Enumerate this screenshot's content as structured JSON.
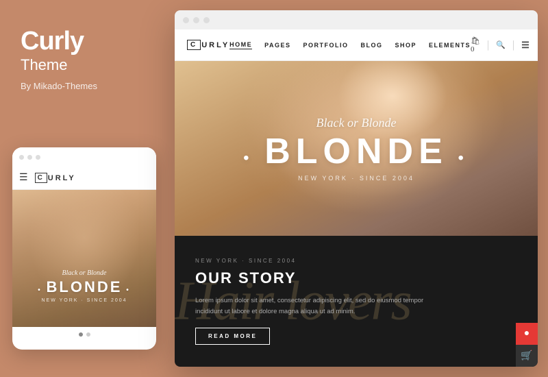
{
  "brand": {
    "title": "Curly",
    "subtitle": "Theme",
    "by": "By Mikado-Themes"
  },
  "mobile": {
    "titlebar_dots": [
      "dot1",
      "dot2",
      "dot3"
    ],
    "logo_letter": "C",
    "logo_text": "URLY",
    "hero": {
      "script": "Black or Blonde",
      "headline": "BLONDE",
      "tagline": "NEW YORK · SINCE 2004"
    },
    "dots": [
      true,
      false
    ]
  },
  "desktop": {
    "nav": {
      "logo_letter": "C",
      "logo_text": "URLY",
      "links": [
        {
          "label": "HOME",
          "active": true
        },
        {
          "label": "PAGES",
          "active": false
        },
        {
          "label": "PORTFOLIO",
          "active": false
        },
        {
          "label": "BLOG",
          "active": false
        },
        {
          "label": "SHOP",
          "active": false
        },
        {
          "label": "ELEMENTS",
          "active": false
        }
      ],
      "cart_label": "0",
      "search_icon": "🔍",
      "menu_icon": "☰"
    },
    "hero": {
      "script": "Black or Blonde",
      "headline": "BLONDE",
      "tagline": "NEW YORK · SINCE 2004"
    },
    "story": {
      "bg_text": "Hair lovers",
      "eyebrow": "NEW YORK · SINCE 2004",
      "title": "OUR STORY",
      "body": "Lorem ipsum dolor sit amet, consectetur adipiscing elit, sed do eiusmod tempor incididunt ut labore et dolore magna aliqua ut ad minim.",
      "button": "READ MORE"
    }
  },
  "colors": {
    "background": "#c4896a",
    "hero_bg": "#c09060",
    "story_bg": "#1a1a1a",
    "story_accent": "rgba(180,150,100,0.25)"
  }
}
